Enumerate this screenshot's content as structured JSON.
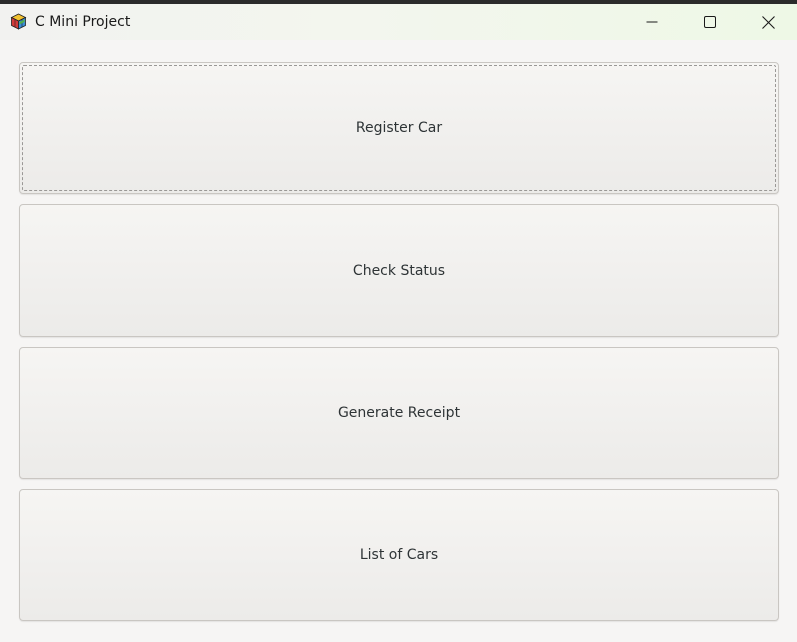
{
  "window": {
    "title": "C Mini Project",
    "icon": "multicolor-cube-icon",
    "controls": [
      "minimize-icon",
      "maximize-icon",
      "close-icon"
    ]
  },
  "menu": {
    "buttons": [
      {
        "label": "Register Car",
        "focused": true
      },
      {
        "label": "Check Status",
        "focused": false
      },
      {
        "label": "Generate Receipt",
        "focused": false
      },
      {
        "label": "List of Cars",
        "focused": false
      }
    ]
  },
  "colors": {
    "background": "#f6f5f4",
    "button_border": "#c9c6c2",
    "text": "#2e3436"
  }
}
